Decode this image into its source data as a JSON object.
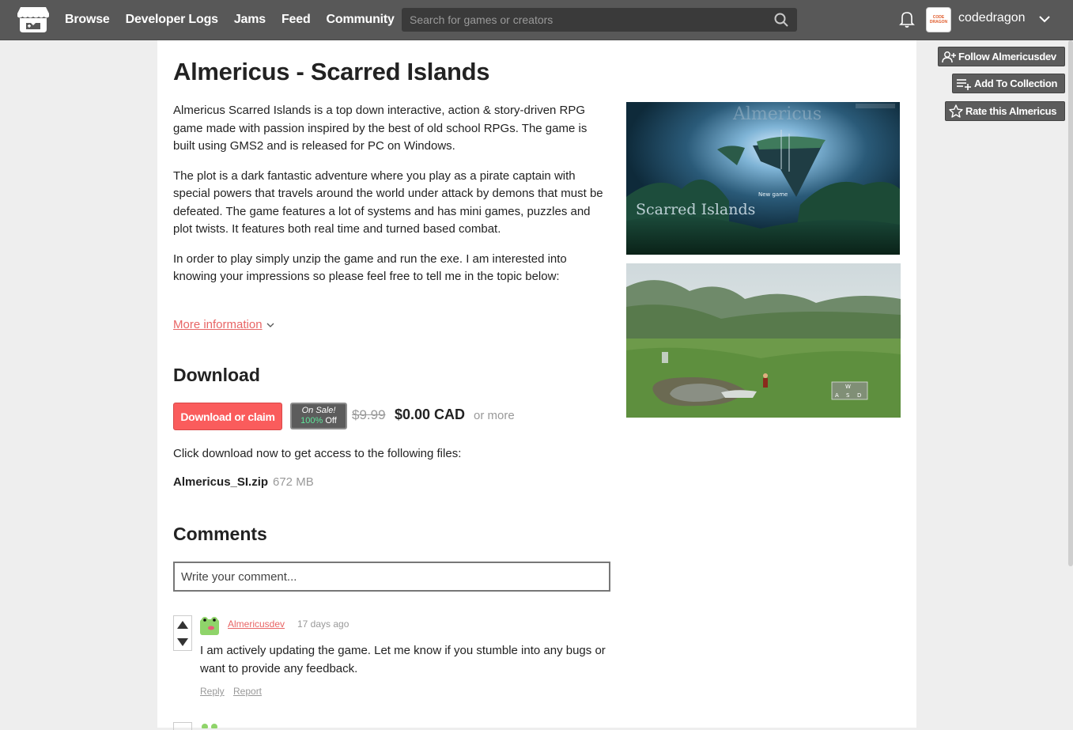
{
  "header": {
    "nav": [
      "Browse",
      "Developer Logs",
      "Jams",
      "Feed",
      "Community"
    ],
    "search_placeholder": "Search for games or creators",
    "username": "codedragon",
    "avatar_text": "CODE DRAGON"
  },
  "game": {
    "title": "Almericus - Scarred Islands",
    "description": [
      "Almericus Scarred Islands is a top down interactive,  action & story-driven RPG game made with passion inspired by the best of old school RPGs. The game is built using GMS2 and is released for PC on Windows.",
      "The plot is a dark fantastic adventure where you play as a pirate captain with special powers that travels around the world under attack by demons that must be defeated.  The game features a lot of systems and has mini games, puzzles and plot twists. It features both real time and turned based combat.",
      "In order to play simply unzip the game and run the exe.  I am interested into knowing your impressions so please feel free to tell me in the topic below:"
    ],
    "more_information": "More information",
    "screenshot1_title": "Scarred Islands",
    "screenshot1_menu": "New game",
    "screenshot2_keys": [
      "W",
      "A",
      "S",
      "D"
    ]
  },
  "download": {
    "heading": "Download",
    "button_label": "Download or claim",
    "sale_on": "On Sale!",
    "sale_pct": "100%",
    "sale_off": "Off",
    "old_price": "$9.99",
    "new_price": "$0.00 CAD",
    "or_more": "or more",
    "files_text": "Click download now to get access to the following files:",
    "file_name": "Almericus_SI.zip",
    "file_size": "672 MB"
  },
  "comments": {
    "heading": "Comments",
    "placeholder": "Write your comment...",
    "items": [
      {
        "author": "Almericusdev",
        "time": "17 days ago",
        "text": "I am actively updating the game. Let me know if you stumble into any bugs or want to provide any feedback.",
        "reply": "Reply",
        "report": "Report"
      }
    ]
  },
  "sidebar": {
    "follow": "Follow Almericusdev",
    "add_collection": "Add To Collection",
    "rate": "Rate this Almericus"
  },
  "colors": {
    "accent": "#fa5c5c",
    "header_bg": "#585858",
    "link": "#e86565"
  }
}
